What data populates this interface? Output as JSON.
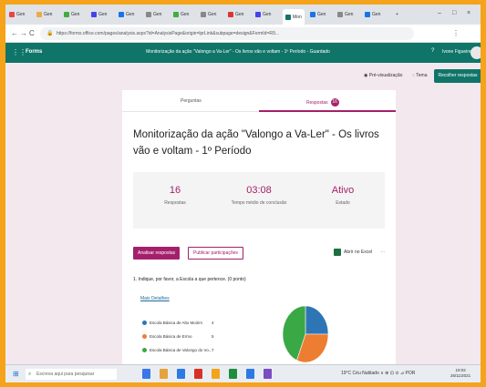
{
  "browser": {
    "tabs": [
      {
        "label": "Gen",
        "color": "#e44"
      },
      {
        "label": "Gen",
        "color": "#ea4"
      },
      {
        "label": "Gen",
        "color": "#4a4"
      },
      {
        "label": "Gen",
        "color": "#44e"
      },
      {
        "label": "Gen",
        "color": "#1a73e8"
      },
      {
        "label": "Gen",
        "color": "#888"
      },
      {
        "label": "Gen",
        "color": "#4a4"
      },
      {
        "label": "Gen",
        "color": "#888"
      },
      {
        "label": "Gen",
        "color": "#d33"
      },
      {
        "label": "Gen",
        "color": "#44e"
      },
      {
        "label": "Gen",
        "color": "#1a73e8"
      },
      {
        "label": "Gen",
        "color": "#888"
      },
      {
        "label": "Gen",
        "color": "#1a73e8"
      }
    ],
    "active_tab": "Mon",
    "new_tab": "+",
    "window_controls": [
      "–",
      "□",
      "×"
    ],
    "nav": [
      "←",
      "→",
      "C"
    ],
    "url": "https://forms.office.com/pages/analysis.aspx?id=AnalysisPage&origin=lprLink&subpage=design&FormId=R9..."
  },
  "app": {
    "brand": "Forms",
    "doc_title": "Monitorização da ação \"Valongo a Va-Ler\" - Os livros vão e voltam - 1º Período  -  Guardado",
    "help": "?",
    "user": "Ivone Figueiredo"
  },
  "toolbar": {
    "preview": "Pré-visualização",
    "theme": "Tema",
    "share": "Recolher respostas"
  },
  "form": {
    "tab_questions": "Perguntas",
    "tab_responses": "Respostas",
    "response_count_badge": "16",
    "title": "Monitorização da ação \"Valongo a Va-Ler\" - Os livros vão e voltam - 1º Período",
    "stats": [
      {
        "value": "16",
        "label": "Respostas"
      },
      {
        "value": "03:08",
        "label": "Tempo médio de conclusão"
      },
      {
        "value": "Ativo",
        "label": "Estado"
      }
    ],
    "view_results": "Analisar respostas",
    "publish_results": "Publicar participações",
    "open_excel": "Abrir no Excel",
    "more_options": "···",
    "question_1": "1. Indique, por favor, a Escola a que pertence. (0 ponto)",
    "more_details": "Mais Detalhes",
    "legend": [
      {
        "name": "Escola Básica de Alto Moirim",
        "count": "4",
        "color": "#2e75b6"
      },
      {
        "name": "Escola Básica de Ermo",
        "count": "5",
        "color": "#ed7d31"
      },
      {
        "name": "Escola Básica de Valongo do Vo...",
        "count": "7",
        "color": "#3aa845"
      }
    ]
  },
  "chart_data": {
    "type": "pie",
    "categories": [
      "Escola Básica de Alto Moirim",
      "Escola Básica de Ermo",
      "Escola Básica de Valongo do Vo..."
    ],
    "values": [
      4,
      5,
      7
    ],
    "colors": [
      "#2e75b6",
      "#ed7d31",
      "#3aa845"
    ]
  },
  "taskbar": {
    "start_icon": "windows-icon",
    "search_placeholder": "Escreva aqui para pesquisar",
    "tray": "19°C Céu Nublado  ∧  ⊕  ⊡  ⊙  ⊿  POR",
    "time": "19:02",
    "date": "26/11/2021",
    "app_icons": [
      "#3b78e7",
      "#e7a23b",
      "#2c7be5",
      "#d93025",
      "#f5a31a",
      "#1e8e3e",
      "#2c7be5",
      "#7a4cc2"
    ]
  }
}
